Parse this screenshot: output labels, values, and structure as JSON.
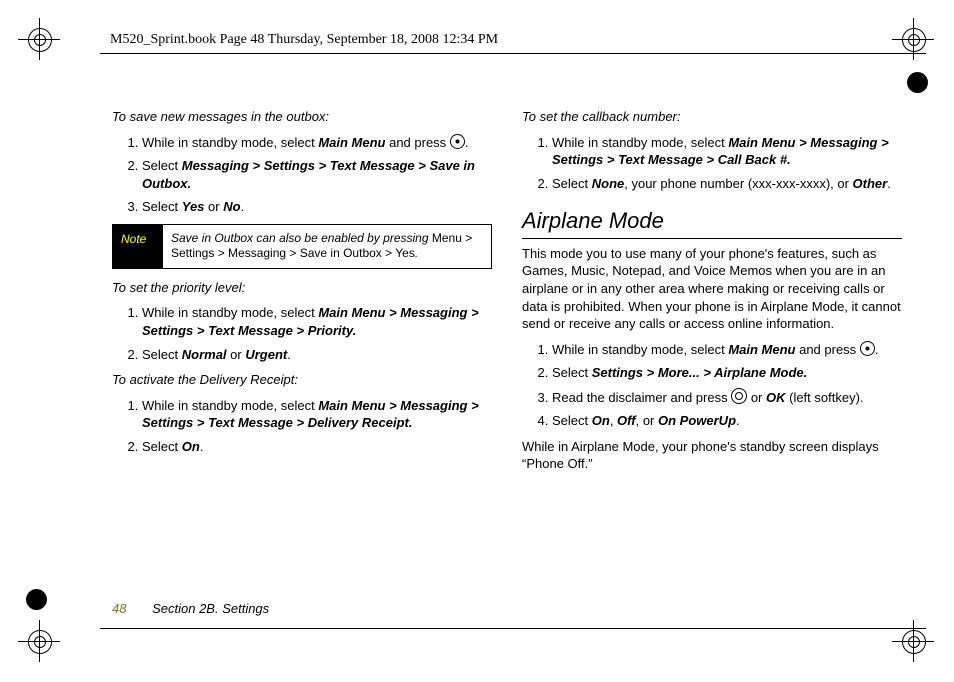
{
  "header": "M520_Sprint.book  Page 48  Thursday, September 18, 2008  12:34 PM",
  "footer": {
    "page": "48",
    "section": "Section 2B. Settings"
  },
  "left": {
    "lead1": "To save new messages in the outbox:",
    "s1": {
      "i1a": "While in standby mode, select ",
      "i1b": "Main Menu",
      "i1c": " and press ",
      "i1d": ".",
      "i2a": "Select ",
      "i2b": "Messaging > Settings > Text Message > Save in Outbox.",
      "i3a": "Select ",
      "i3b": "Yes",
      "i3c": " or ",
      "i3d": "No",
      "i3e": "."
    },
    "note": {
      "label": "Note",
      "a": "Save in Outbox can also be enabled by pressing ",
      "b": "Menu > Settings > Messaging > Save in Outbox > Yes",
      "c": "."
    },
    "lead2": "To set the priority level:",
    "s2": {
      "i1a": "While in standby mode, select ",
      "i1b": "Main Menu > Messaging > Settings > Text Message > Priority.",
      "i2a": "Select ",
      "i2b": "Normal",
      "i2c": " or ",
      "i2d": "Urgent",
      "i2e": "."
    },
    "lead3": "To activate the Delivery Receipt:",
    "s3": {
      "i1a": "While in standby mode, select ",
      "i1b": "Main Menu > Messaging > Settings > Text Message > Delivery Receipt.",
      "i2a": "Select ",
      "i2b": "On",
      "i2c": "."
    }
  },
  "right": {
    "lead1": "To set the callback number:",
    "s1": {
      "i1a": "While in standby mode, select ",
      "i1b": "Main Menu > Messaging > Settings > Text Message > Call Back #.",
      "i2a": "Select ",
      "i2b": "None",
      "i2c": ", your phone number (xxx-xxx-xxxx), or ",
      "i2d": "Other",
      "i2e": "."
    },
    "h2": "Airplane Mode",
    "para": "This mode you to use many of your phone's features, such as Games, Music, Notepad, and Voice Memos when you are in an airplane or in any other area where making or receiving calls or data is prohibited. When your phone is in Airplane Mode, it cannot send or receive any calls or access online information.",
    "s2": {
      "i1a": "While in standby mode, select ",
      "i1b": "Main Menu",
      "i1c": " and press ",
      "i1d": ".",
      "i2a": "Select ",
      "i2b": "Settings > More... > Airplane Mode.",
      "i3a": "Read the disclaimer and press ",
      "i3b": " or ",
      "i3c": "OK",
      "i3d": " (left softkey).",
      "i4a": "Select ",
      "i4b": "On",
      "i4c": ", ",
      "i4d": "Off",
      "i4e": ", or ",
      "i4f": "On PowerUp",
      "i4g": "."
    },
    "closing": "While in Airplane Mode, your phone's standby screen displays “Phone Off.”"
  }
}
